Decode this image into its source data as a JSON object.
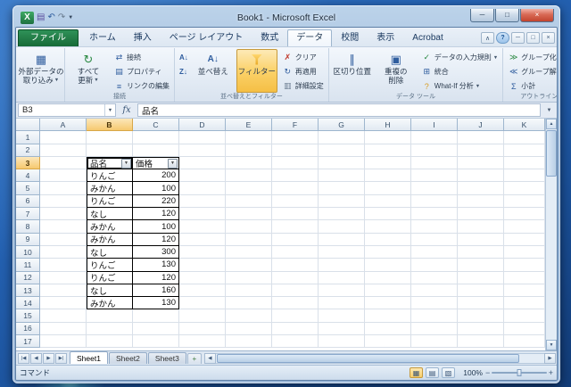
{
  "icons": {
    "excel_logo": "X",
    "save": "▤",
    "undo": "↶",
    "redo": "↷",
    "dropdown": "▼",
    "ribbon_collapse": "∧",
    "help": "?",
    "win_min": "─",
    "win_max": "□",
    "win_close": "×",
    "book_min": "─",
    "book_restore": "□",
    "book_close": "×",
    "external_data": "▦",
    "refresh": "↻",
    "connection": "⇄",
    "properties": "▤",
    "edit_links": "≡",
    "sort_az": "A↓",
    "sort_za": "Z↓",
    "clear": "✗",
    "reapply": "↻",
    "advanced": "▥",
    "text_to_columns": "∥",
    "remove_duplicates": "▣",
    "validation": "✓",
    "consolidate": "⊞",
    "whatif": "?",
    "group": "≫",
    "ungroup": "≪",
    "subtotal": "Σ",
    "dialog_launcher": "◢",
    "name_dropdown": "▼",
    "formula_expand": "▼",
    "scroll_up": "▲",
    "scroll_down": "▼",
    "scroll_left": "◀",
    "scroll_right": "▶",
    "tab_first": "|◀",
    "tab_prev": "◀",
    "tab_next": "▶",
    "tab_last": "▶|",
    "insert_sheet": "+",
    "view_normal": "▦",
    "view_layout": "▤",
    "view_break": "▧",
    "zoom_out": "−",
    "zoom_in": "+",
    "filter_dropdown": "▼"
  },
  "window": {
    "title": "Book1 - Microsoft Excel"
  },
  "ribbon": {
    "active_tab": "データ",
    "tabs": [
      {
        "label": "ファイル",
        "type": "file"
      },
      {
        "label": "ホーム"
      },
      {
        "label": "挿入"
      },
      {
        "label": "ページ レイアウト"
      },
      {
        "label": "数式"
      },
      {
        "label": "データ"
      },
      {
        "label": "校閲"
      },
      {
        "label": "表示"
      },
      {
        "label": "Acrobat"
      }
    ],
    "groups": {
      "external": {
        "line1": "外部データの",
        "line2": "取り込み"
      },
      "connections": {
        "label": "接続",
        "refresh1": "すべて",
        "refresh2": "更新",
        "connections": "接続",
        "properties": "プロパティ",
        "edit_links": "リンクの編集"
      },
      "sortfilter": {
        "label": "並べ替えとフィルター",
        "sort": "並べ替え",
        "filter": "フィルター",
        "clear": "クリア",
        "reapply": "再適用",
        "advanced": "詳細設定"
      },
      "datatools": {
        "label": "データ ツール",
        "text_to_columns": "区切り位置",
        "dup1": "重複の",
        "dup2": "削除",
        "validation": "データの入力規則",
        "consolidate": "統合",
        "whatif": "What-If 分析"
      },
      "outline": {
        "label": "アウトライン",
        "group": "グループ化",
        "ungroup": "グループ解除",
        "subtotal": "小計"
      }
    }
  },
  "formula": {
    "name_box": "B3",
    "fx": "fx",
    "value": "品名"
  },
  "sheet": {
    "columns": [
      "A",
      "B",
      "C",
      "D",
      "E",
      "F",
      "G",
      "H",
      "I",
      "J",
      "K"
    ],
    "row_count": 17,
    "selected_col": "B",
    "selected_row": 3,
    "table": {
      "origin_col": "B",
      "origin_row": 3,
      "headers": [
        "品名",
        "価格"
      ],
      "rows": [
        [
          "りんご",
          200
        ],
        [
          "みかん",
          100
        ],
        [
          "りんご",
          220
        ],
        [
          "なし",
          120
        ],
        [
          "みかん",
          100
        ],
        [
          "みかん",
          120
        ],
        [
          "なし",
          300
        ],
        [
          "りんご",
          130
        ],
        [
          "りんご",
          120
        ],
        [
          "なし",
          160
        ],
        [
          "みかん",
          130
        ]
      ]
    }
  },
  "sheet_tabs": {
    "tabs": [
      "Sheet1",
      "Sheet2",
      "Sheet3"
    ],
    "active": "Sheet1"
  },
  "status": {
    "mode": "コマンド",
    "zoom": "100%"
  }
}
